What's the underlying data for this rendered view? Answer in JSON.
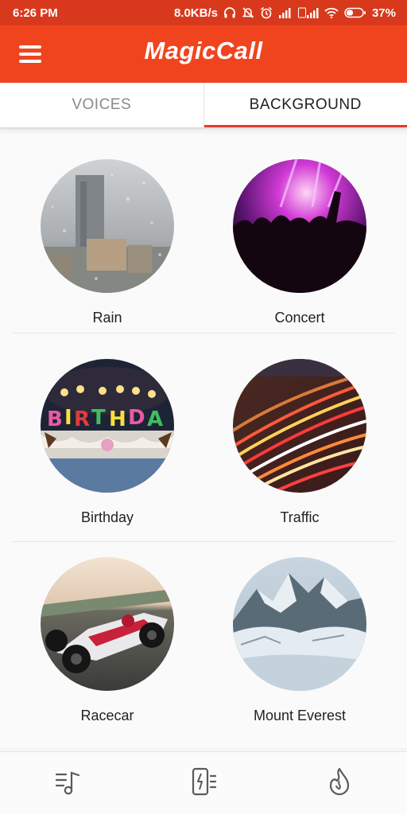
{
  "status_bar": {
    "time": "6:26 PM",
    "net_speed": "8.0KB/s",
    "battery": "37%"
  },
  "app": {
    "title": "MagicCall",
    "brand_color": "#f0441f"
  },
  "tabs": [
    {
      "label": "VOICES",
      "active": false
    },
    {
      "label": "BACKGROUND",
      "active": true
    }
  ],
  "backgrounds": [
    {
      "label": "Rain"
    },
    {
      "label": "Concert"
    },
    {
      "label": "Birthday"
    },
    {
      "label": "Traffic"
    },
    {
      "label": "Racecar"
    },
    {
      "label": "Mount Everest"
    }
  ],
  "bottom_nav": [
    {
      "icon": "music-note-list-icon"
    },
    {
      "icon": "phone-vibrate-icon"
    },
    {
      "icon": "flame-icon"
    }
  ]
}
